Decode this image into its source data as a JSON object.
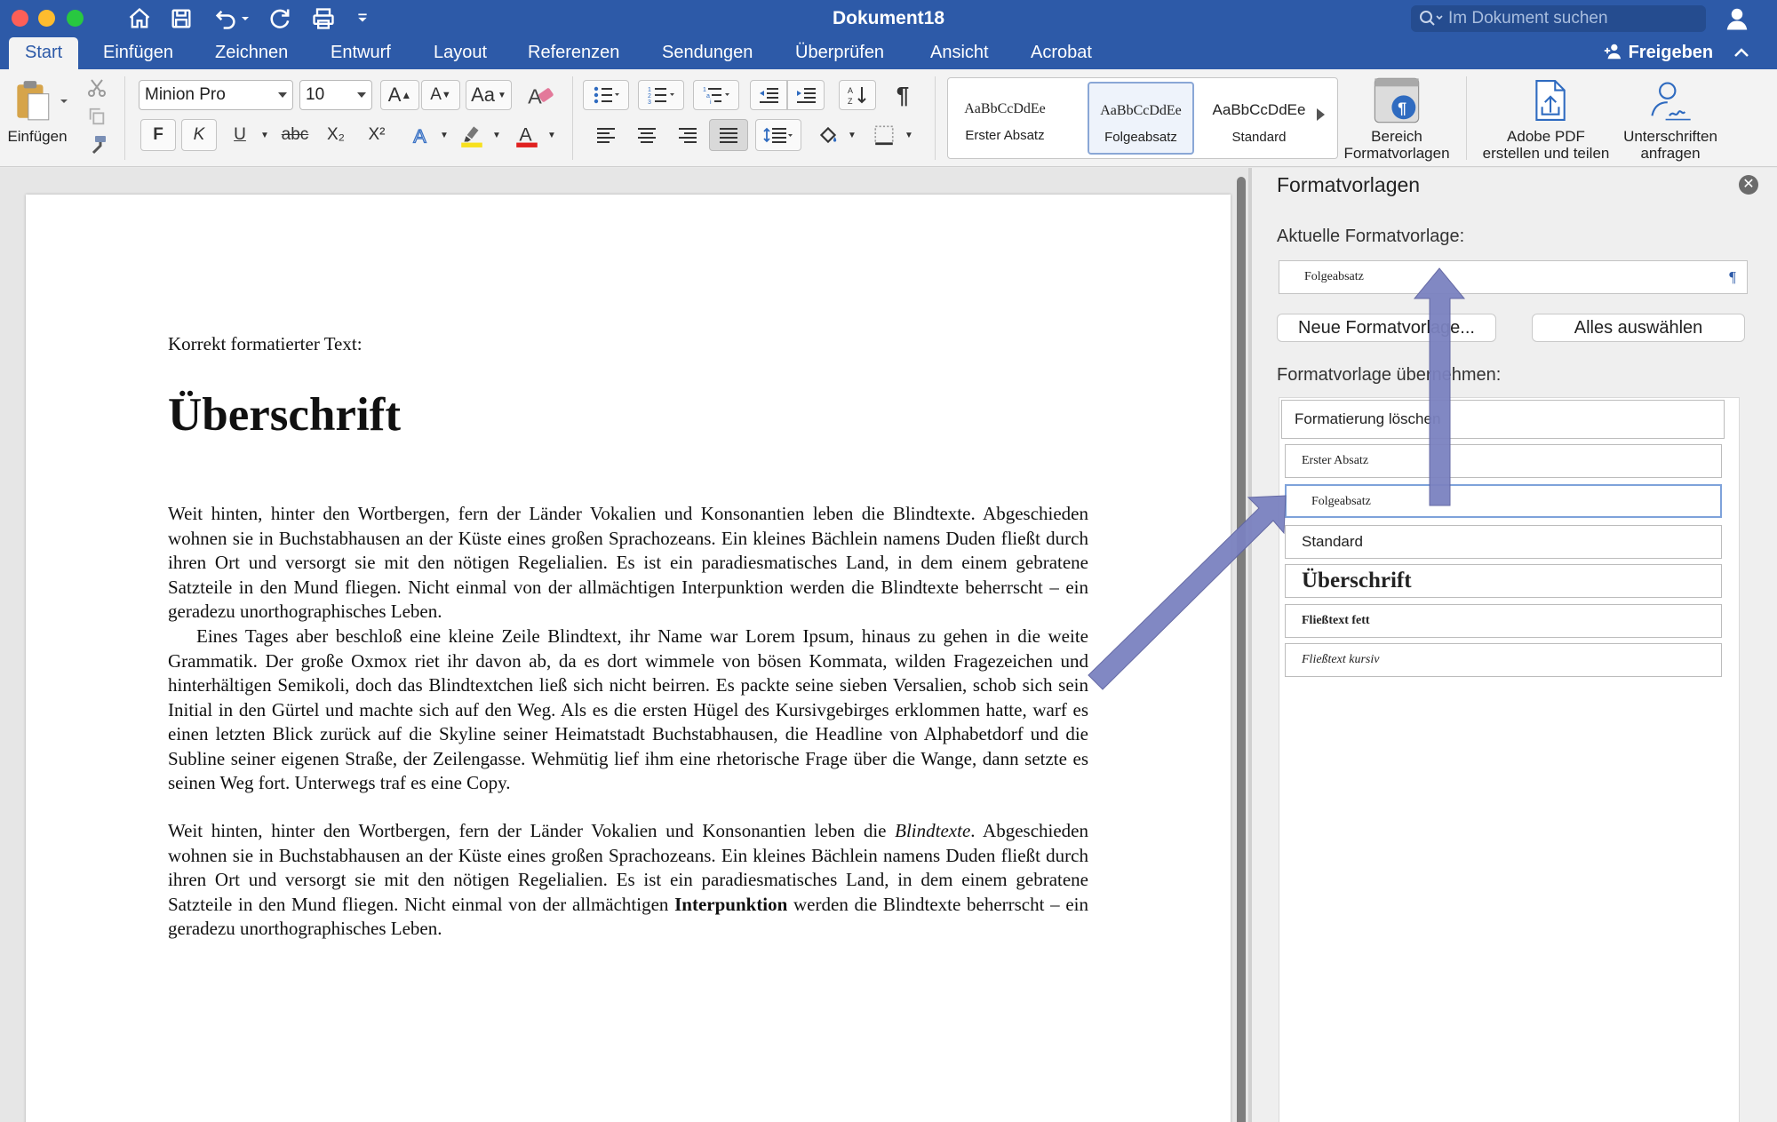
{
  "window": {
    "title": "Dokument18"
  },
  "search": {
    "placeholder": "Im Dokument suchen"
  },
  "tabs": [
    "Start",
    "Einfügen",
    "Zeichnen",
    "Entwurf",
    "Layout",
    "Referenzen",
    "Sendungen",
    "Überprüfen",
    "Ansicht",
    "Acrobat"
  ],
  "share_label": "Freigeben",
  "ribbon": {
    "paste_label": "Einfügen",
    "font_name": "Minion Pro",
    "font_size": "10",
    "bold": "F",
    "italic": "K",
    "underline": "U",
    "strike": "abc",
    "sub": "X₂",
    "sup": "X²",
    "style_tiles": [
      {
        "sample": "AaBbCcDdEe",
        "name": "Erster Absatz"
      },
      {
        "sample": "AaBbCcDdEe",
        "name": "Folgeabsatz"
      },
      {
        "sample": "AaBbCcDdEe",
        "name": "Standard"
      }
    ],
    "pane_btn_line1": "Bereich",
    "pane_btn_line2": "Formatvorlagen",
    "pdf_line1": "Adobe PDF",
    "pdf_line2": "erstellen und teilen",
    "sign_line1": "Unterschriften",
    "sign_line2": "anfragen"
  },
  "document": {
    "label": "Korrekt formatierter Text:",
    "heading": "Überschrift",
    "para1": "Weit hinten, hinter den Wortbergen, fern der Länder Vokalien und Konsonantien leben die Blindtexte. Abgeschieden wohnen sie in Buchstabhausen an der Küste eines großen Sprachozeans. Ein kleines Bächlein namens Duden fließt durch ihren Ort und versorgt sie mit den nötigen Regelialien. Es ist ein paradiesmatisches Land, in dem einem gebratene Satzteile in den Mund fliegen. Nicht einmal von der allmächtigen Interpunktion werden die Blindtexte beherrscht – ein geradezu unorthographisches Leben.",
    "para2": "Eines Tages aber beschloß eine kleine Zeile Blindtext, ihr Name war Lorem Ipsum, hinaus zu gehen in die weite Grammatik. Der große Oxmox riet ihr davon ab, da es dort wimmele von bösen Kommata, wilden Fragezeichen und hinterhältigen Semikoli, doch das Blindtextchen ließ sich nicht beirren. Es packte seine sieben Versalien, schob sich sein Initial in den Gürtel und machte sich auf den Weg. Als es die ersten Hügel des Kursivgebirges erklommen hatte, warf es einen letzten Blick zurück auf die Skyline seiner Heimatstadt Buchstabhausen, die Headline von Alphabetdorf und die Subline seiner eigenen Straße, der Zeilengasse. Wehmütig lief ihm eine rhetorische Frage über die Wange, dann setzte es seinen Weg fort. Unterwegs traf es eine Copy.",
    "para3_a": "Weit hinten, hinter den Wortbergen, fern der Länder Vokalien und Konsonantien leben die ",
    "para3_italic": "Blindtexte",
    "para3_b": ". Abgeschieden wohnen sie in Buchstabhausen an der Küste eines großen Sprachozeans. Ein kleines Bächlein namens Duden fließt durch ihren Ort und versorgt sie mit den nötigen Regelialien. Es ist ein paradiesmatisches Land, in dem einem gebratene Satzteile in den Mund fliegen. Nicht einmal von der allmächtigen ",
    "para3_bold": "Interpunktion",
    "para3_c": " werden die Blindtexte beherrscht – ein geradezu unorthographisches Leben."
  },
  "pane": {
    "title": "Formatvorlagen",
    "current_label": "Aktuelle Formatvorlage:",
    "current_value": "Folgeabsatz",
    "new_style_btn": "Neue Formatvorlage...",
    "select_all_btn": "Alles auswählen",
    "apply_label": "Formatvorlage übernehmen:",
    "list": [
      "Formatierung löschen",
      "Erster Absatz",
      "Folgeabsatz",
      "Standard",
      "Überschrift",
      "Fließtext fett",
      "Fließtext kursiv"
    ]
  },
  "colors": {
    "accent": "#2d5aa8",
    "arrow": "#7b82c0"
  }
}
